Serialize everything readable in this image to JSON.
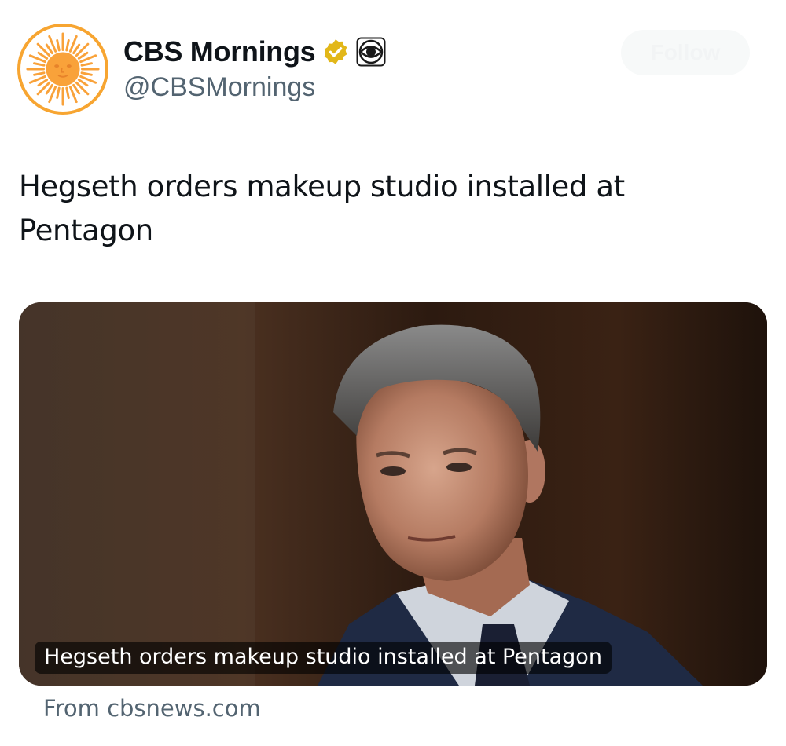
{
  "account": {
    "display_name": "CBS Mornings",
    "handle": "@CBSMornings",
    "verified_badge": "gold-verified-icon",
    "affiliate_badge": "cbs-eye-icon",
    "avatar_icon": "sun-logo-icon"
  },
  "follow_button": {
    "label": "Follow"
  },
  "tweet": {
    "text": "Hegseth orders makeup studio installed at Pentagon"
  },
  "card": {
    "caption": "Hegseth orders makeup studio installed at Pentagon",
    "source": "From cbsnews.com"
  },
  "colors": {
    "avatar_ring": "#f7a531",
    "sun": "#f9a23a",
    "verified_gold": "#e2b719",
    "handle_gray": "#536471"
  }
}
